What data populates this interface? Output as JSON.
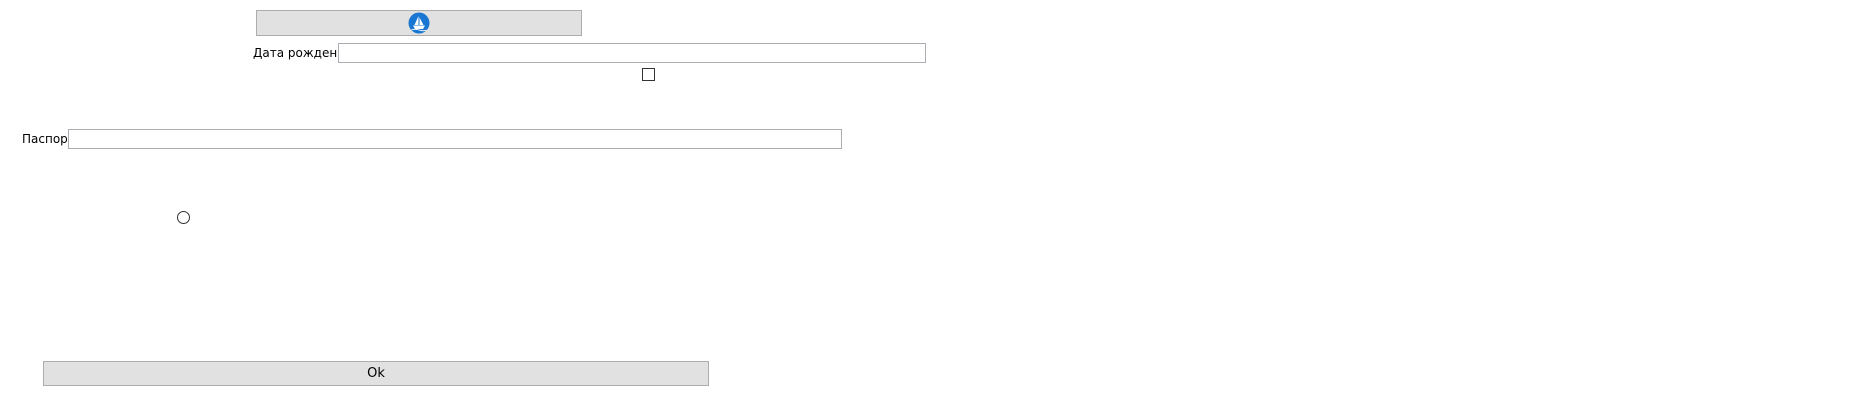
{
  "form": {
    "photo_button": {
      "icon": "sailing-ship-icon",
      "icon_bg_color": "#1976d2",
      "label": ""
    },
    "birth_date": {
      "label": "Дата рождения",
      "value": "",
      "placeholder": ""
    },
    "flag_checkbox": {
      "checked": false,
      "label": ""
    },
    "passport": {
      "label": "Паспорт",
      "value": "",
      "placeholder": ""
    },
    "option_radio": {
      "checked": false,
      "label": ""
    },
    "ok_button": {
      "label": "Ok"
    }
  },
  "colors": {
    "button_face": "#e1e1e1",
    "button_border": "#adadad",
    "textbox_border": "#abadb3"
  }
}
